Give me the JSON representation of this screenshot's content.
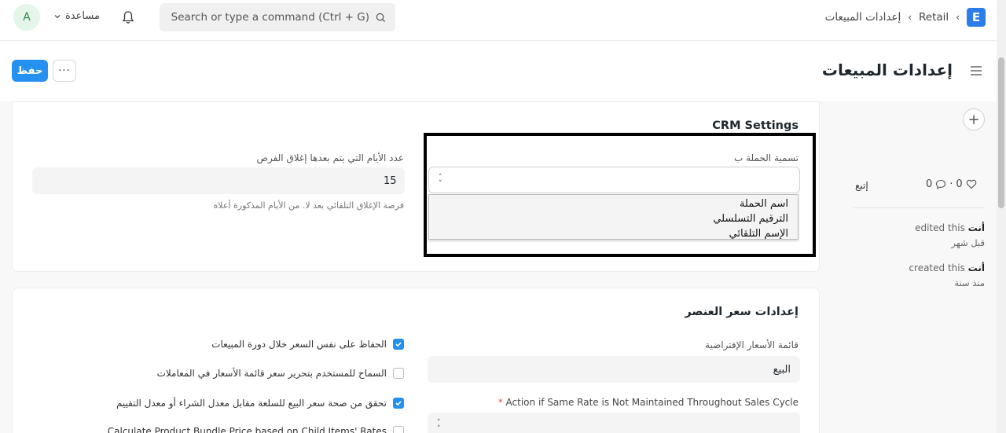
{
  "navbar": {
    "avatar_letter": "A",
    "help_label": "مساعدة",
    "search_placeholder": "Search or type a command (Ctrl + G)",
    "logo_letter": "E",
    "breadcrumbs": [
      "Retail",
      "إعدادات المبيعات"
    ]
  },
  "page": {
    "title": "إعدادات المبيعات",
    "save_label": "حفظ",
    "more_label": "···"
  },
  "crm": {
    "title": "CRM Settings",
    "campaign_naming_label": "تسمية الحملة ب",
    "campaign_naming_options": [
      "اسم الحملة",
      "الترقيم التسلسلي",
      "الإسم التلقائي"
    ],
    "close_days_label": "عدد الأيام التي يتم بعدها إغلاق الفرص",
    "close_days_value": "15",
    "close_days_hint": "فرصة الإغلاق التلقائي بعد لا. من الأيام المذكورة أعلاه"
  },
  "item_price": {
    "title": "إعدادات سعر العنصر",
    "default_price_list_label": "قائمة الأسعار الإفتراضية",
    "default_price_list_value": "البيع",
    "action_label": "Action if Same Rate is Not Maintained Throughout Sales Cycle",
    "action_required_mark": "*",
    "checkboxes": [
      {
        "label": "الحفاظ على نفس السعر خلال دورة المبيعات",
        "checked": true
      },
      {
        "label": "السماح للمستخدم بتحرير سعر قائمة الأسعار في المعاملات",
        "checked": false
      },
      {
        "label": "تحقق من صحة سعر البيع للسلعة مقابل معدل الشراء أو معدل التقييم",
        "checked": true
      },
      {
        "label": "Calculate Product Bundle Price based on Child Items' Rates",
        "checked": false
      }
    ]
  },
  "sidebar": {
    "follow_label": "إتبع",
    "likes": "0",
    "comments": "0",
    "separator": "·",
    "activity": [
      {
        "who": "أنت",
        "action": "edited this",
        "when": "قبل شهر"
      },
      {
        "who": "أنت",
        "action": "created this",
        "when": "منذ سنة"
      }
    ]
  },
  "colors": {
    "primary": "#2490ef",
    "logo": "#2b7de9"
  }
}
